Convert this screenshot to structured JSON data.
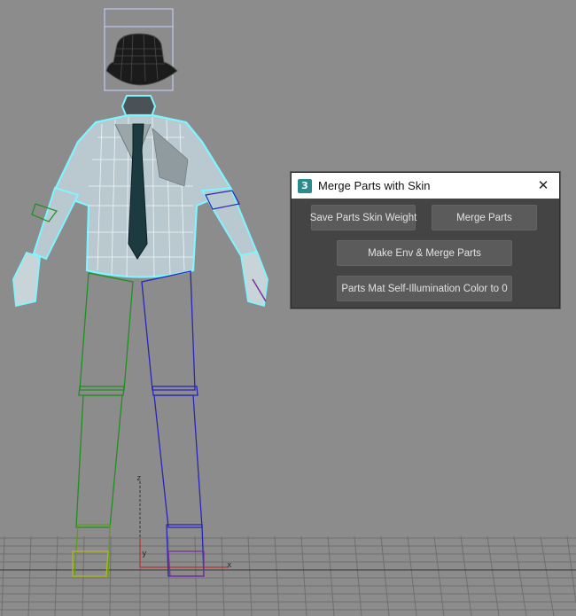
{
  "viewport": {
    "axis_labels": {
      "z": "z",
      "x": "x",
      "y": "y"
    }
  },
  "dialog": {
    "title": "Merge Parts with Skin",
    "app_icon": "3",
    "close_glyph": "✕",
    "buttons": {
      "save_parts_skin_weight": "Save Parts Skin Weight",
      "merge_parts": "Merge Parts",
      "make_env_merge_parts": "Make Env & Merge Parts",
      "parts_mat_self_illum": "Parts Mat Self-Illumination Color to 0"
    }
  },
  "colors": {
    "viewport_bg": "#8c8c8c",
    "dialog_bg": "#444444",
    "button_bg": "#5b5b5b",
    "selection_cyan": "#7ff5ff",
    "left_leg_green": "#1f8f1f",
    "right_leg_blue": "#2626b8",
    "grid_line": "#6e6e6e"
  }
}
